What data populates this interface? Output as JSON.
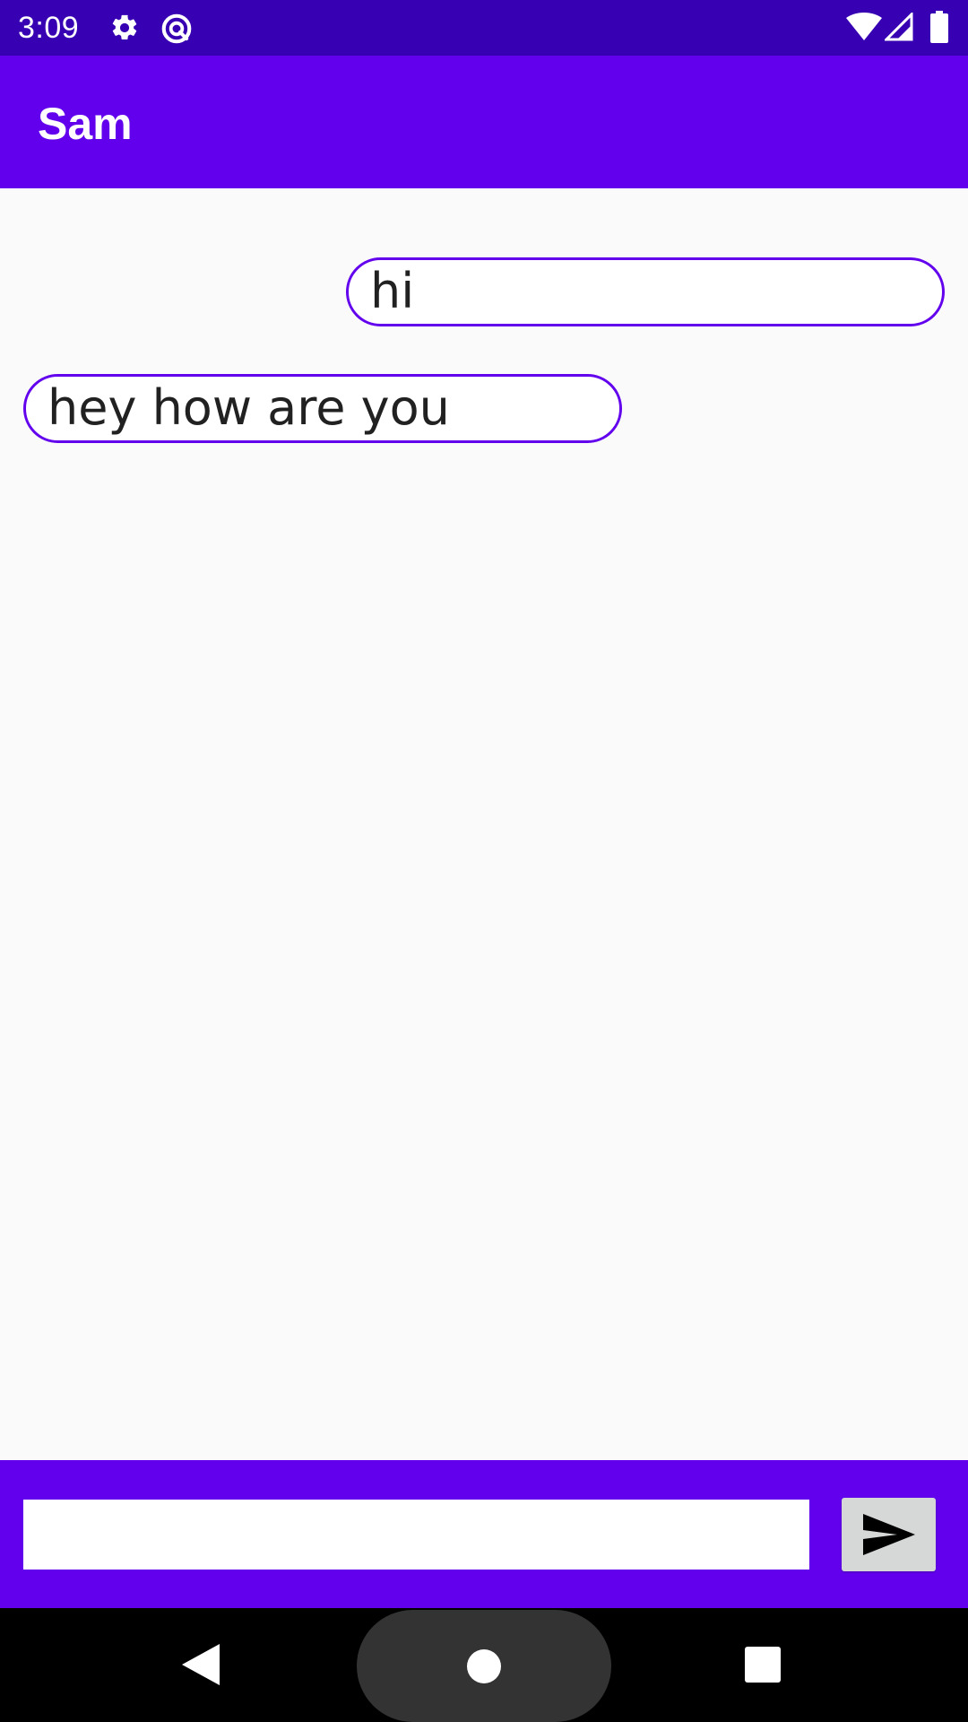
{
  "status_bar": {
    "time": "3:09",
    "icons": [
      "settings-gear-icon",
      "sync-circle-icon",
      "wifi-icon",
      "cell-signal-icon",
      "battery-icon"
    ]
  },
  "app_bar": {
    "title": "Sam"
  },
  "messages": [
    {
      "direction": "sent",
      "text": "hi"
    },
    {
      "direction": "received",
      "text": "hey how are you"
    }
  ],
  "composer": {
    "input_value": "",
    "send_icon": "send-icon"
  },
  "navigation": {
    "buttons": [
      "back-icon",
      "home-icon",
      "recents-icon"
    ]
  },
  "colors": {
    "status_bar": "#3700B3",
    "primary": "#6200EE",
    "background": "#FAFAFA",
    "bubble_border": "#6200EE",
    "send_button": "#D6D7D7",
    "nav_bar": "#000000"
  }
}
